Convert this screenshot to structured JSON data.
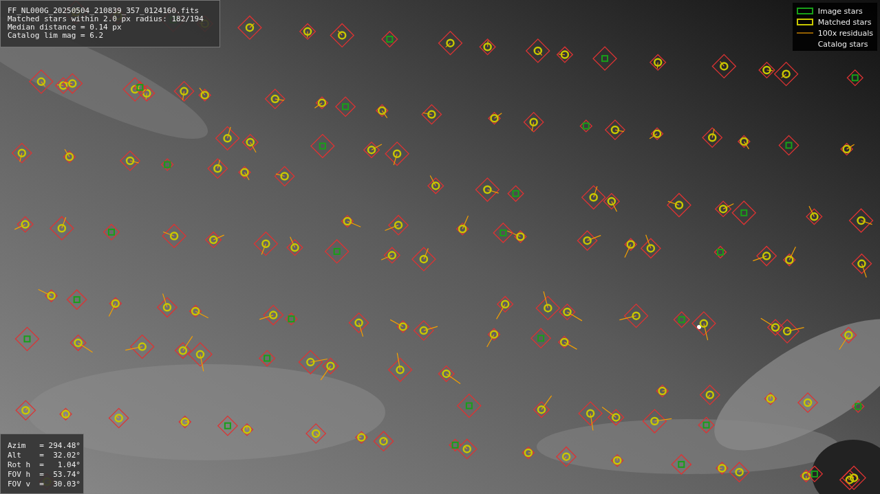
{
  "info": {
    "lines": [
      "FF_NL000G_20250504_210839_357_0124160.fits",
      "Matched stars within 2.0 px radius: 182/194",
      "Median distance = 0.14 px",
      "Catalog lim mag = 6.2"
    ]
  },
  "legend": [
    {
      "label": "Image stars"
    },
    {
      "kind": "matched",
      "label": "Matched stars"
    },
    {
      "kind": "residual",
      "label": "100x residuals"
    },
    {
      "kind": "catalog",
      "label": "Catalog stars"
    }
  ],
  "pointing": {
    "lines": [
      "Azim   = 294.48°",
      "Alt    =  32.02°",
      "Rot h  =   1.04°",
      "FOV h  =  53.74°",
      "FOV v  =  30.03°"
    ]
  }
}
